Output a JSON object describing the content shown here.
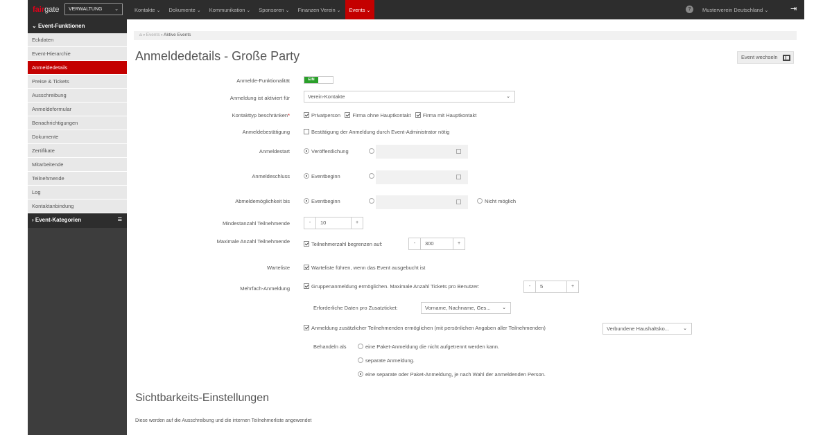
{
  "topnav": {
    "logo_a": "fair",
    "logo_b": "gate",
    "module": "VERWALTUNG",
    "menu": [
      {
        "label": "Kontakte"
      },
      {
        "label": "Dokumente"
      },
      {
        "label": "Kommunikation"
      },
      {
        "label": "Sponsoren"
      },
      {
        "label": "Finanzen Verein"
      },
      {
        "label": "Events"
      }
    ],
    "help": "?",
    "org": "Musterverein Deutschland"
  },
  "sidebar": {
    "header": "Event-Funktionen",
    "items": [
      "Eckdaten",
      "Event-Hierarchie",
      "Anmeldedetails",
      "Preise & Tickets",
      "Ausschreibung",
      "Anmeldeformular",
      "Benachrichtigungen",
      "Dokumente",
      "Zertifikate",
      "Mitarbeitende",
      "Teilnehmende",
      "Log",
      "Kontaktanbindung"
    ],
    "categories": "Event-Kategorien"
  },
  "breadcrumb": {
    "level1": "Events",
    "level2": "Aktive Events"
  },
  "page_title": "Anmeldedetails - Große Party",
  "switch_event": "Event wechseln",
  "form": {
    "funktionalitaet_label": "Anmelde-Funktionalität",
    "toggle_on": "EIN",
    "aktiviert_label": "Anmeldung ist aktiviert für",
    "aktiviert_value": "Verein-Kontakte",
    "kontakttyp_label": "Kontakttyp beschränken",
    "req": "*",
    "kontakttyp_options": [
      "Privatperson",
      "Firma ohne Hauptkontakt",
      "Firma mit Hauptkontakt"
    ],
    "bestaetigung_label": "Anmeldebestätigung",
    "bestaetigung_text": "Bestätigung der Anmeldung durch Event-Administrator nötig",
    "anmeldestart_label": "Anmeldestart",
    "anmeldestart_option": "Veröffentlichung",
    "anmeldeschluss_label": "Anmeldeschluss",
    "anmeldeschluss_option": "Eventbeginn",
    "abmelde_label": "Abmeldemöglichkeit bis",
    "abmelde_option": "Eventbeginn",
    "abmelde_nicht": "Nicht möglich",
    "min_label": "Mindestanzahl Teilnehmende",
    "min_value": "10",
    "max_label": "Maximale Anzahl Teilnehmende",
    "max_check": "Teilnehmerzahl begrenzen auf:",
    "max_value": "300",
    "warteliste_label": "Warteliste",
    "warteliste_text": "Warteliste führen, wenn das Event ausgebucht ist",
    "mehrfach_label": "Mehrfach-Anmeldung",
    "gruppe_text": "Gruppenanmeldung ermöglichen. Maximale Anzahl Tickets pro Benutzer:",
    "gruppe_value": "5",
    "erforderlich_label": "Erforderliche Daten pro Zusatzticket:",
    "erforderlich_value": "Vorname, Nachname, Ges...",
    "zusatz_text": "Anmeldung zusätzlicher Teilnehmenden ermöglichen (mit persönlichen Angaben aller Teilnehmenden)",
    "zusatz_value": "Verbundene Haushaltsko...",
    "behandeln_label": "Behandeln als",
    "behandeln_options": [
      "eine Paket-Anmeldung die nicht aufgetrennt werden kann.",
      "separate Anmeldung.",
      "eine separate oder Paket-Anmeldung, je nach Wahl der anmeldenden Person."
    ],
    "minus": "-",
    "plus": "+"
  },
  "visibility": {
    "title": "Sichtbarkeits-Einstellungen",
    "note": "Diese werden auf die Ausschreibung und die internen Teilnehmerliste angewendet"
  }
}
